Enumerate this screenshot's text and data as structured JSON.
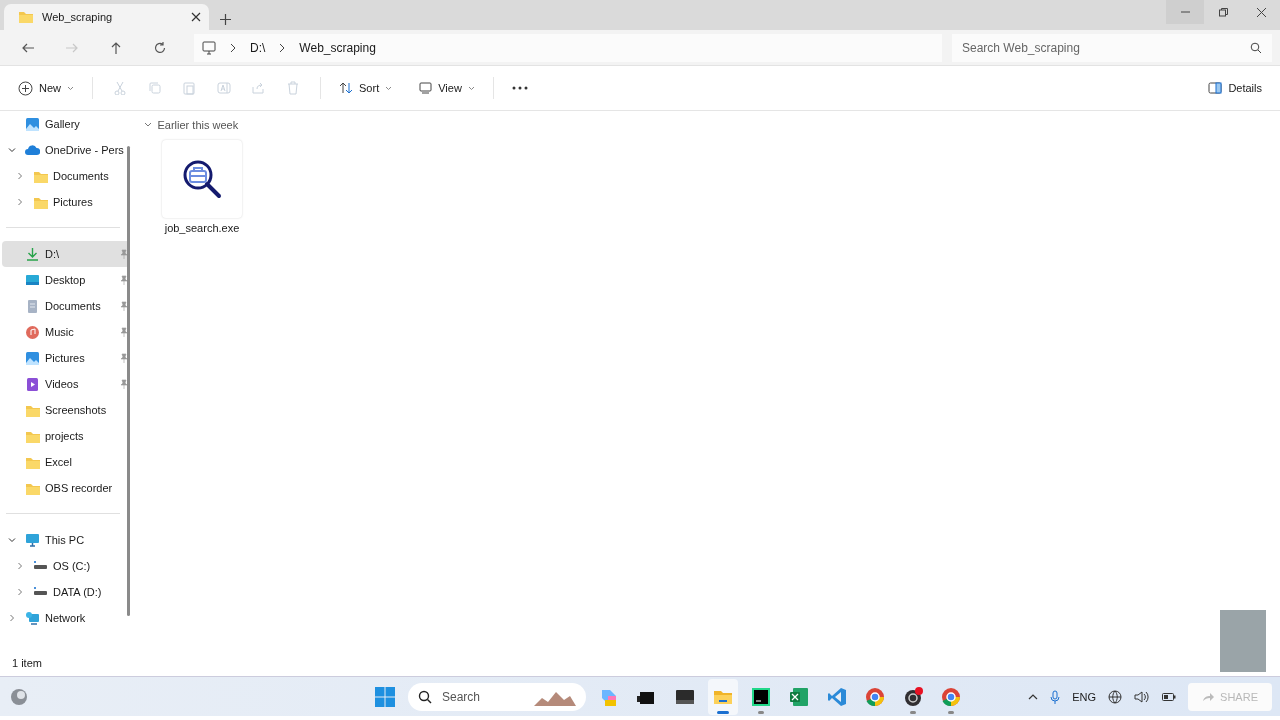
{
  "tabs": [
    {
      "title": "Web_scraping",
      "selected": true
    }
  ],
  "address": {
    "crumbs": [
      "D:\\",
      "Web_scraping"
    ],
    "search_placeholder": "Search Web_scraping"
  },
  "toolbar": {
    "new_label": "New",
    "sort_label": "Sort",
    "view_label": "View",
    "details_label": "Details"
  },
  "nav_groups": [
    [
      {
        "label": "Gallery",
        "kind": "gallery",
        "selected": false
      },
      {
        "label": "OneDrive - Pers",
        "kind": "cloud",
        "expanded": true,
        "selected": false,
        "children": [
          {
            "label": "Documents",
            "kind": "folder",
            "expanded": false,
            "selected": false
          },
          {
            "label": "Pictures",
            "kind": "folder",
            "expanded": false,
            "selected": false
          }
        ]
      }
    ],
    [
      {
        "label": "D:\\",
        "kind": "download",
        "pinned": true,
        "selected": true
      },
      {
        "label": "Desktop",
        "kind": "desktop",
        "pinned": true,
        "selected": false
      },
      {
        "label": "Documents",
        "kind": "document",
        "pinned": true,
        "selected": false
      },
      {
        "label": "Music",
        "kind": "music",
        "pinned": true,
        "selected": false
      },
      {
        "label": "Pictures",
        "kind": "gallery",
        "pinned": true,
        "selected": false
      },
      {
        "label": "Videos",
        "kind": "video",
        "pinned": true,
        "selected": false
      },
      {
        "label": "Screenshots",
        "kind": "folder",
        "pinned": false,
        "selected": false
      },
      {
        "label": "projects",
        "kind": "folder",
        "pinned": false,
        "selected": false
      },
      {
        "label": "Excel",
        "kind": "folder",
        "pinned": false,
        "selected": false
      },
      {
        "label": "OBS recorder",
        "kind": "folder",
        "pinned": false,
        "selected": false
      }
    ],
    [
      {
        "label": "This PC",
        "kind": "pc",
        "expanded": true,
        "selected": false,
        "children": [
          {
            "label": "OS (C:)",
            "kind": "drive",
            "expanded": false,
            "selected": false
          },
          {
            "label": "DATA (D:)",
            "kind": "drive",
            "expanded": false,
            "selected": false
          }
        ]
      },
      {
        "label": "Network",
        "kind": "network",
        "expanded": false,
        "selected": false
      }
    ]
  ],
  "content": {
    "group_label": "Earlier this week",
    "files": [
      {
        "name": "job_search.exe"
      }
    ]
  },
  "status_bar": {
    "count": "1 item"
  },
  "taskbar": {
    "search_label": "Search",
    "apps": [
      {
        "kind": "store",
        "active": false,
        "running": false
      },
      {
        "kind": "terminal",
        "active": false,
        "running": false
      },
      {
        "kind": "explorer",
        "active": true,
        "running": true
      },
      {
        "kind": "pycharm",
        "active": false,
        "running": true
      },
      {
        "kind": "excel",
        "active": false,
        "running": false
      },
      {
        "kind": "vscode",
        "active": false,
        "running": false
      },
      {
        "kind": "chrome",
        "active": false,
        "running": false
      },
      {
        "kind": "obs",
        "active": false,
        "running": true
      },
      {
        "kind": "chrome",
        "active": false,
        "running": true
      }
    ],
    "language": "ENG",
    "share_label": "SHARE"
  }
}
